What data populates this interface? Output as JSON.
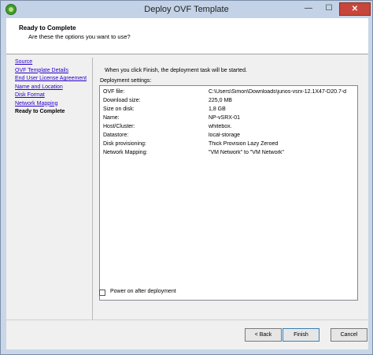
{
  "window": {
    "title": "Deploy OVF Template",
    "minimize_glyph": "—",
    "maximize_glyph": "☐",
    "close_glyph": "✕"
  },
  "header": {
    "step_title": "Ready to Complete",
    "step_subtitle": "Are these the options you want to use?"
  },
  "nav": {
    "items": [
      {
        "label": "Source"
      },
      {
        "label": "OVF Template Details"
      },
      {
        "label": "End User License Agreement"
      },
      {
        "label": "Name and Location"
      },
      {
        "label": "Disk Format"
      },
      {
        "label": "Network Mapping"
      },
      {
        "label": "Ready to Complete"
      }
    ]
  },
  "main": {
    "info_text": "When you click Finish, the deployment task will be started.",
    "settings_label": "Deployment settings:",
    "settings": [
      {
        "key": "OVF file:",
        "value": "C:\\Users\\Simon\\Downloads\\junos-vsrx-12.1X47-D20.7-d"
      },
      {
        "key": "Download size:",
        "value": "225,0 MB"
      },
      {
        "key": "Size on disk:",
        "value": "1,8 GB"
      },
      {
        "key": "Name:",
        "value": "NP-vSRX-01"
      },
      {
        "key": "Host/Cluster:",
        "value": "whitebox."
      },
      {
        "key": "Datastore:",
        "value": "local-storage"
      },
      {
        "key": "Disk provisioning:",
        "value": "Thick Provision Lazy Zeroed"
      },
      {
        "key": "Network Mapping:",
        "value": "\"VM Network\" to \"VM Network\""
      }
    ],
    "power_on_label": "Power on after deployment",
    "power_on_checked": false
  },
  "footer": {
    "back_label": "< Back",
    "finish_label": "Finish",
    "cancel_label": "Cancel"
  },
  "colors": {
    "link": "#2a00c8",
    "close_button": "#c7463b",
    "title_bar": "#c3d2e6"
  }
}
